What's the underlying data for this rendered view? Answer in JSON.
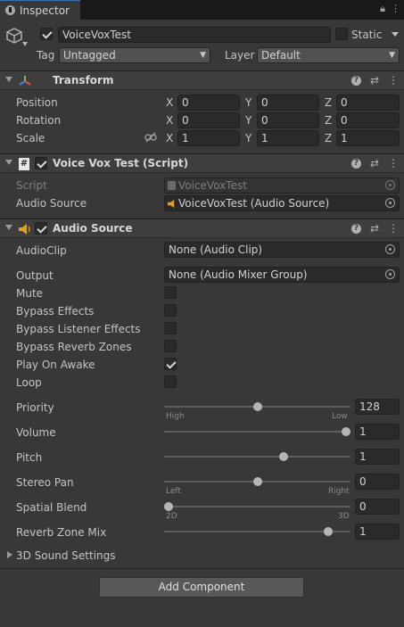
{
  "tab": {
    "title": "Inspector"
  },
  "gameobject": {
    "name": "VoiceVoxTest",
    "static_label": "Static",
    "tag_label": "Tag",
    "tag_value": "Untagged",
    "layer_label": "Layer",
    "layer_value": "Default"
  },
  "transform": {
    "title": "Transform",
    "rows": [
      {
        "label": "Position",
        "x": "0",
        "y": "0",
        "z": "0"
      },
      {
        "label": "Rotation",
        "x": "0",
        "y": "0",
        "z": "0"
      },
      {
        "label": "Scale",
        "x": "1",
        "y": "1",
        "z": "1"
      }
    ],
    "axis": {
      "x": "X",
      "y": "Y",
      "z": "Z"
    }
  },
  "script": {
    "title": "Voice Vox Test (Script)",
    "script_label": "Script",
    "script_value": "VoiceVoxTest",
    "audio_label": "Audio Source",
    "audio_value": "VoiceVoxTest (Audio Source)"
  },
  "audio": {
    "title": "Audio Source",
    "clip_label": "AudioClip",
    "clip_value": "None (Audio Clip)",
    "output_label": "Output",
    "output_value": "None (Audio Mixer Group)",
    "mute": "Mute",
    "bypass_effects": "Bypass Effects",
    "bypass_listener": "Bypass Listener Effects",
    "bypass_reverb": "Bypass Reverb Zones",
    "play_on_awake": "Play On Awake",
    "loop": "Loop",
    "priority_label": "Priority",
    "priority_value": "128",
    "priority_fraction": 0.5,
    "priority_low_hint": "High",
    "priority_high_hint": "Low",
    "volume_label": "Volume",
    "volume_value": "1",
    "volume_fraction": 1.0,
    "pitch_label": "Pitch",
    "pitch_value": "1",
    "pitch_fraction": 0.65,
    "pan_label": "Stereo Pan",
    "pan_value": "0",
    "pan_fraction": 0.5,
    "pan_left": "Left",
    "pan_right": "Right",
    "spatial_label": "Spatial Blend",
    "spatial_value": "0",
    "spatial_fraction": 0.0,
    "spatial_left": "2D",
    "spatial_right": "3D",
    "reverb_label": "Reverb Zone Mix",
    "reverb_value": "1",
    "reverb_fraction": 0.9,
    "sound3d": "3D Sound Settings"
  },
  "add_component": "Add Component"
}
